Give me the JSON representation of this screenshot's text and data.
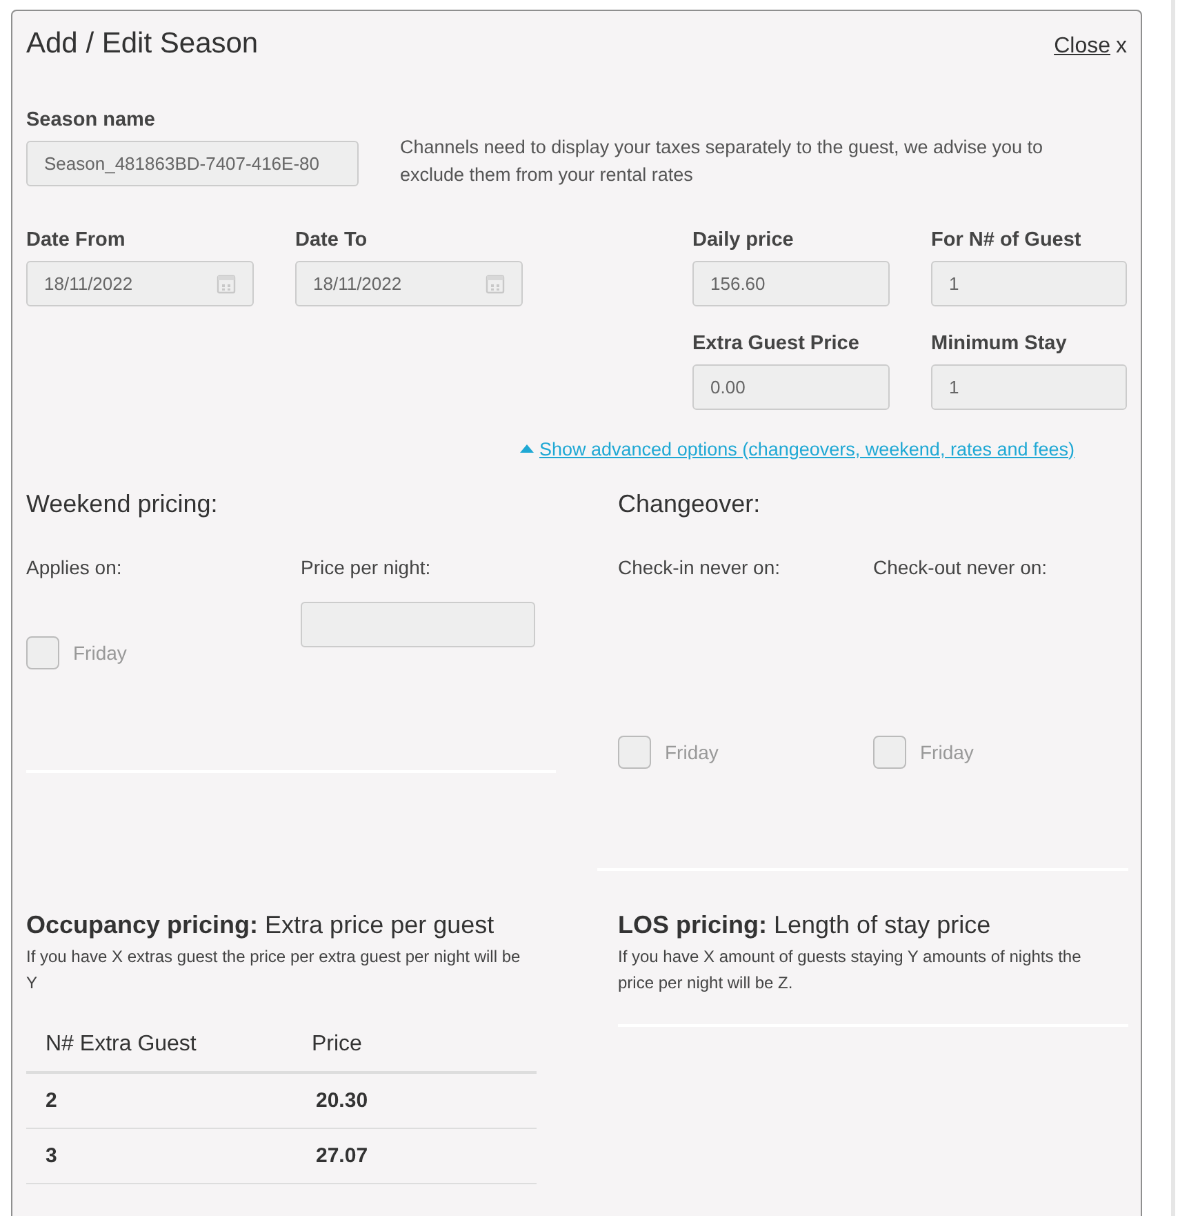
{
  "dialog": {
    "title": "Add / Edit Season",
    "close_link": "Close",
    "close_mark": "x"
  },
  "season_name": {
    "label": "Season name",
    "value": "Season_481863BD-7407-416E-80"
  },
  "tax_notice": "Channels need to display your taxes separately to the guest, we advise you to exclude them from your rental rates",
  "date_fields": [
    {
      "label": "Date From",
      "value": "18/11/2022"
    },
    {
      "label": "Date To",
      "value": "18/11/2022"
    }
  ],
  "price_fields": [
    {
      "label": "Daily price",
      "value": "156.60"
    },
    {
      "label": "For N# of Guest",
      "value": "1"
    },
    {
      "label": "Extra Guest Price",
      "value": "0.00"
    },
    {
      "label": "Minimum Stay",
      "value": "1"
    }
  ],
  "advanced_link": {
    "label": "Show advanced options (changeovers, weekend, rates and fees)",
    "expanded": true
  },
  "weekend_pricing": {
    "title": "Weekend pricing:",
    "applies_on_label": "Applies on:",
    "days": [
      {
        "label": "Friday",
        "checked": false
      }
    ],
    "price_label": "Price per night:"
  },
  "changeover": {
    "title": "Changeover:",
    "columns": [
      {
        "label": "Check-in never on:",
        "days": [
          {
            "label": "Friday",
            "checked": false
          }
        ]
      },
      {
        "label": "Check-out never on:",
        "days": [
          {
            "label": "Friday",
            "checked": false
          }
        ]
      }
    ]
  },
  "occupancy_pricing": {
    "title": "**Occupancy pricing:** Extra price per guest",
    "description": "If you have X extras guest the price per extra guest per night will be Y",
    "table": {
      "columns": [
        "N# Extra Guest",
        "Price"
      ],
      "rows": [
        [
          "2",
          "20.30"
        ],
        [
          "3",
          "27.07"
        ]
      ]
    }
  },
  "los_pricing": {
    "title": "**LOS pricing:** Length of stay price",
    "description": "If you have X amount of guests staying Y amounts of nights the price per night will be Z."
  }
}
